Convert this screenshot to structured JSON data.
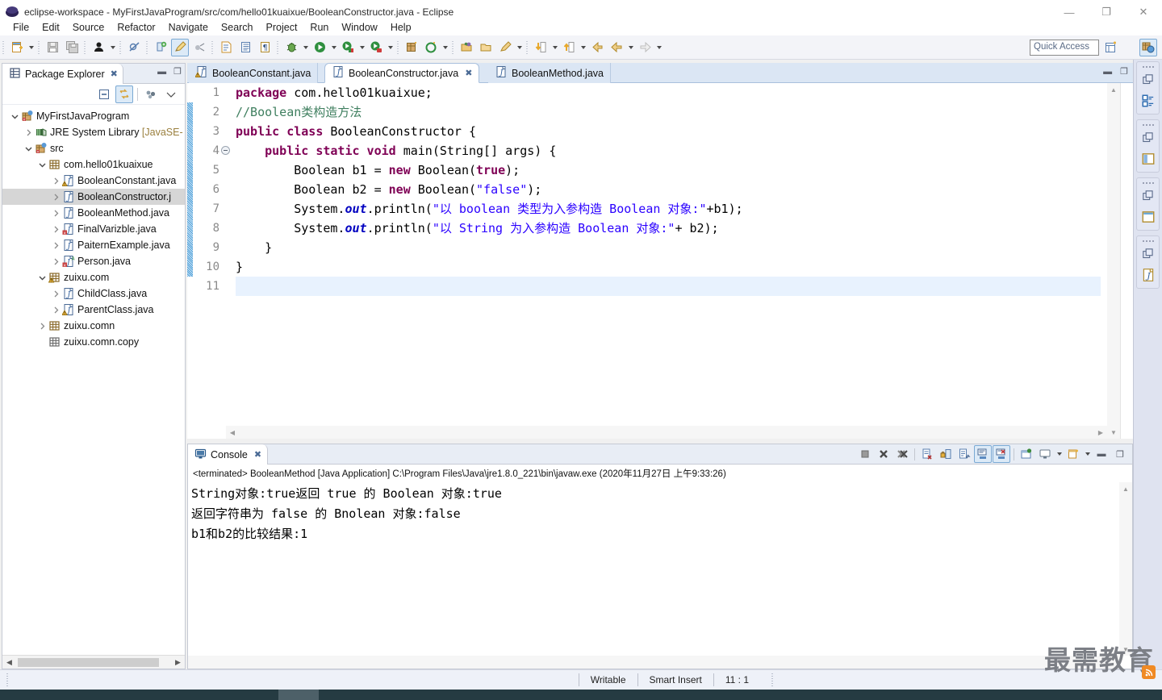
{
  "window": {
    "title": "eclipse-workspace - MyFirstJavaProgram/src/com/hello01kuaixue/BooleanConstructor.java - Eclipse",
    "minimize": "—",
    "maximize": "❐",
    "close": "✕"
  },
  "menubar": {
    "items": [
      "File",
      "Edit",
      "Source",
      "Refactor",
      "Navigate",
      "Search",
      "Project",
      "Run",
      "Window",
      "Help"
    ]
  },
  "toolbar": {
    "quick_access": "Quick Access",
    "icons": [
      "new-file-icon",
      "save-icon",
      "save-all-icon",
      "person-icon",
      "skip-breakpoints-icon",
      "toggle-mark-occurrences-icon",
      "pencil-highlight-icon",
      "link-icon",
      "open-type-icon",
      "open-task-icon",
      "show-whitespace-icon",
      "debug-icon",
      "run-icon",
      "external-tools-icon",
      "run-last-tool-icon",
      "new-java-project-icon",
      "new-annotation-icon",
      "open-resource-icon",
      "open-folder-icon",
      "edit-icon",
      "next-annotation-icon",
      "previous-annotation-icon",
      "back-icon",
      "forward-icon",
      "next-edit-icon",
      "new-window-icon",
      "java-perspective-icon"
    ]
  },
  "package_explorer": {
    "tab_label": "Package Explorer",
    "tab_icon": "package-explorer-icon",
    "close_icon": "close-icon",
    "minimize_icon": "minimize-icon",
    "maximize_icon": "maximize-icon",
    "toolbar_icons": [
      "collapse-all-icon",
      "link-with-editor-icon",
      "view-menu-filter-icon",
      "view-menu-chevron-icon"
    ],
    "tree": [
      {
        "label": "MyFirstJavaProgram",
        "indent": 0,
        "twisty": "down",
        "icon": "java-project-icon",
        "selected": false
      },
      {
        "label": "JRE System Library ",
        "suffix": "[JavaSE-",
        "indent": 1,
        "twisty": "right",
        "icon": "library-icon",
        "selected": false
      },
      {
        "label": "src",
        "indent": 1,
        "twisty": "down",
        "icon": "source-folder-icon",
        "selected": false
      },
      {
        "label": "com.hello01kuaixue",
        "indent": 2,
        "twisty": "down",
        "icon": "package-icon",
        "selected": false
      },
      {
        "label": "BooleanConstant.java",
        "indent": 3,
        "twisty": "right",
        "icon": "java-file-warning-icon",
        "selected": false
      },
      {
        "label": "BooleanConstructor.j",
        "indent": 3,
        "twisty": "right",
        "icon": "java-file-icon",
        "selected": true
      },
      {
        "label": "BooleanMethod.java",
        "indent": 3,
        "twisty": "right",
        "icon": "java-file-icon",
        "selected": false
      },
      {
        "label": "FinalVarizble.java",
        "indent": 3,
        "twisty": "right",
        "icon": "java-file-error-icon",
        "selected": false
      },
      {
        "label": "PaiternExample.java",
        "indent": 3,
        "twisty": "right",
        "icon": "java-file-icon",
        "selected": false
      },
      {
        "label": "Person.java",
        "indent": 3,
        "twisty": "right",
        "icon": "java-file-error-abstract-icon",
        "selected": false
      },
      {
        "label": "zuixu.com",
        "indent": 2,
        "twisty": "down",
        "icon": "package-warning-icon",
        "selected": false
      },
      {
        "label": "ChildClass.java",
        "indent": 3,
        "twisty": "right",
        "icon": "java-file-icon",
        "selected": false
      },
      {
        "label": "ParentClass.java",
        "indent": 3,
        "twisty": "right",
        "icon": "java-file-warning-icon",
        "selected": false
      },
      {
        "label": "zuixu.comn",
        "indent": 2,
        "twisty": "right",
        "icon": "package-icon",
        "selected": false
      },
      {
        "label": "zuixu.comn.copy",
        "indent": 2,
        "twisty": "none",
        "icon": "package-empty-icon",
        "selected": false
      }
    ]
  },
  "editor": {
    "tabs": [
      {
        "label": "BooleanConstant.java",
        "icon": "java-file-warning-icon",
        "active": false,
        "closable": false
      },
      {
        "label": "BooleanConstructor.java",
        "icon": "java-file-icon",
        "active": true,
        "closable": true
      },
      {
        "label": "BooleanMethod.java",
        "icon": "java-file-icon",
        "active": false,
        "closable": false
      }
    ],
    "close_icon": "close-icon",
    "minimize_icon": "minimize-icon",
    "maximize_icon": "maximize-icon",
    "line_numbers": [
      "1",
      "2",
      "3",
      "4",
      "5",
      "6",
      "7",
      "8",
      "9",
      "10",
      "11"
    ],
    "fold_line": 4,
    "current_line": 11,
    "change_bar_lines": [
      2,
      10
    ],
    "code": [
      [
        {
          "t": "package",
          "c": "kw"
        },
        {
          "t": " com.hello01kuaixue;",
          "c": "plain"
        }
      ],
      [
        {
          "t": "//Boolean类构造方法",
          "c": "cmt"
        }
      ],
      [
        {
          "t": "public class",
          "c": "kw"
        },
        {
          "t": " BooleanConstructor {",
          "c": "plain"
        }
      ],
      [
        {
          "t": "    ",
          "c": "plain"
        },
        {
          "t": "public static void",
          "c": "kw"
        },
        {
          "t": " main(String[] args) {",
          "c": "plain"
        }
      ],
      [
        {
          "t": "        Boolean b1 = ",
          "c": "plain"
        },
        {
          "t": "new",
          "c": "kw"
        },
        {
          "t": " Boolean(",
          "c": "plain"
        },
        {
          "t": "true",
          "c": "kw"
        },
        {
          "t": ");",
          "c": "plain"
        }
      ],
      [
        {
          "t": "        Boolean b2 = ",
          "c": "plain"
        },
        {
          "t": "new",
          "c": "kw"
        },
        {
          "t": " Boolean(",
          "c": "plain"
        },
        {
          "t": "\"false\"",
          "c": "str"
        },
        {
          "t": ");",
          "c": "plain"
        }
      ],
      [
        {
          "t": "        System.",
          "c": "plain"
        },
        {
          "t": "out",
          "c": "fld"
        },
        {
          "t": ".println(",
          "c": "plain"
        },
        {
          "t": "\"以 boolean 类型为入参构造 Boolean 对象:\"",
          "c": "str"
        },
        {
          "t": "+b1);",
          "c": "plain"
        }
      ],
      [
        {
          "t": "        System.",
          "c": "plain"
        },
        {
          "t": "out",
          "c": "fld"
        },
        {
          "t": ".println(",
          "c": "plain"
        },
        {
          "t": "\"以 String 为入参构造 Boolean 对象:\"",
          "c": "str"
        },
        {
          "t": "+ b2);",
          "c": "plain"
        }
      ],
      [
        {
          "t": "    }",
          "c": "plain"
        }
      ],
      [
        {
          "t": "}",
          "c": "plain"
        }
      ],
      [
        {
          "t": "",
          "c": "plain"
        }
      ]
    ]
  },
  "console": {
    "tab_label": "Console",
    "tab_icon": "console-icon",
    "close_icon": "close-icon",
    "toolbar_icons": [
      "terminate-icon",
      "remove-launch-icon",
      "remove-all-terminated-icon",
      "clear-console-icon",
      "lock-scroll-icon",
      "scroll-lock-icon",
      "show-console-on-output-icon",
      "show-console-on-error-icon",
      "pin-console-icon",
      "display-selected-console-icon",
      "open-console-icon",
      "minimize-icon",
      "maximize-icon"
    ],
    "header": "<terminated> BooleanMethod [Java Application] C:\\Program Files\\Java\\jre1.8.0_221\\bin\\javaw.exe (2020年11月27日 上午9:33:26)",
    "lines": [
      "String对象:true返回 true 的 Boolean 对象:true",
      "返回字符串为 false 的 Bnolean 对象:false",
      "b1和b2的比较结果:1"
    ]
  },
  "right_bar": {
    "groups": [
      {
        "restore_icon": "restore-icon",
        "view_icon": "outline-view-icon"
      },
      {
        "restore_icon": "restore-icon",
        "view_icon": "package-explorer-view-icon"
      },
      {
        "restore_icon": "restore-icon",
        "view_icon": "console-view-icon"
      },
      {
        "restore_icon": "restore-icon",
        "view_icon": "java-editor-view-icon"
      }
    ]
  },
  "statusbar": {
    "writable": "Writable",
    "insert_mode": "Smart Insert",
    "position": "11 : 1"
  },
  "watermark": {
    "text": "最需教育",
    "badge_icon": "rss-icon"
  },
  "colors": {
    "keyword": "#7f0055",
    "comment": "#3f7f5f",
    "string": "#2a00ff",
    "field": "#0000c0",
    "tab_active_bg": "#ffffff",
    "tab_inactive_bg": "#dbe6f4",
    "selection": "#d6d6d6",
    "accent": "#7aa9d4"
  }
}
